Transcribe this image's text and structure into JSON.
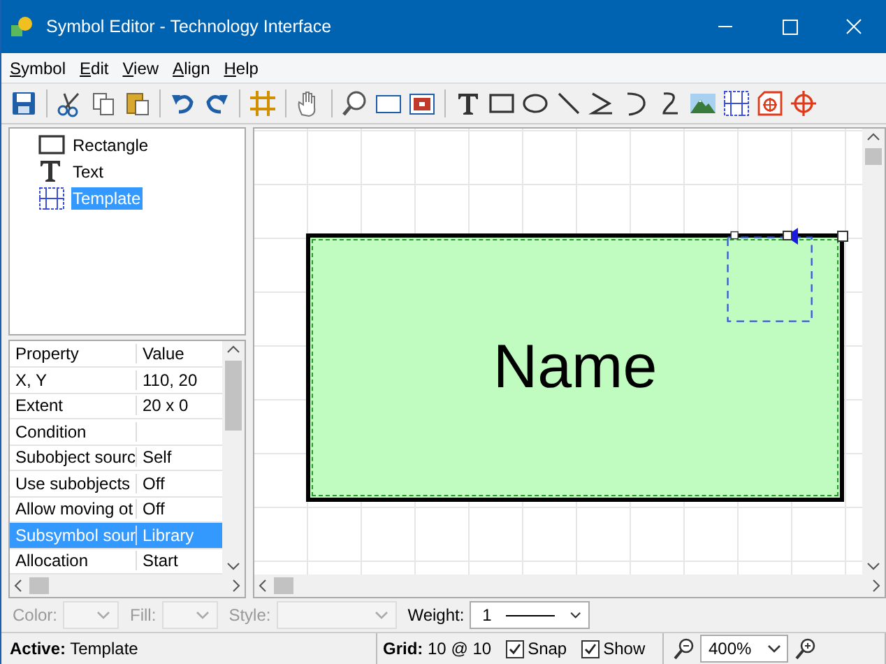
{
  "window": {
    "title": "Symbol Editor - Technology Interface"
  },
  "menu": [
    "Symbol",
    "Edit",
    "View",
    "Align",
    "Help"
  ],
  "tree": [
    {
      "label": "Rectangle",
      "kind": "rectangle",
      "selected": false
    },
    {
      "label": "Text",
      "kind": "text",
      "selected": false
    },
    {
      "label": "Template",
      "kind": "template",
      "selected": true
    }
  ],
  "properties": {
    "columns": [
      "Property",
      "Value"
    ],
    "rows": [
      {
        "name": "X, Y",
        "value": "110, 20",
        "selected": false
      },
      {
        "name": "Extent",
        "value": "20 x 0",
        "selected": false
      },
      {
        "name": "Condition",
        "selected": false
      },
      {
        "name": "Subobject sourc",
        "value": "Self",
        "selected": false
      },
      {
        "name": "Use subobjects",
        "value": "Off",
        "selected": false
      },
      {
        "name": "Allow moving ot",
        "value": "Off",
        "selected": false
      },
      {
        "name": "Subsymbol sour",
        "value": "Library",
        "selected": true
      },
      {
        "name": "Allocation",
        "value": "Start",
        "selected": false
      }
    ]
  },
  "canvas": {
    "shape_text": "Name"
  },
  "format_bar": [
    {
      "label": "Color:",
      "disabled": true
    },
    {
      "label": "Fill:",
      "disabled": true
    },
    {
      "label": "Style:",
      "disabled": true
    },
    {
      "label": "Weight:",
      "disabled": false,
      "value": "1"
    }
  ],
  "status_bar": {
    "active": "**Active:** Template",
    "grid": "**Grid:** 10 @ 10",
    "snap": {
      "label": "Snap",
      "checked": true
    },
    "show": {
      "label": "Show",
      "checked": true
    },
    "zoom": "400%"
  }
}
